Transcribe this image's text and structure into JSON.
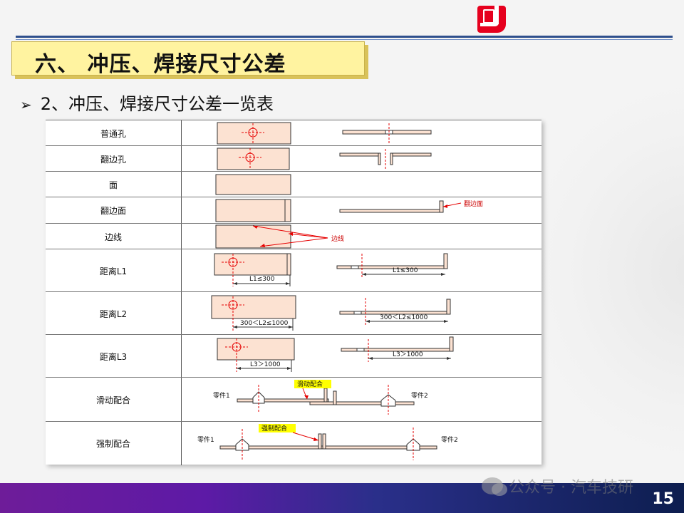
{
  "slide": {
    "title": "六、 冲压、焊接尺寸公差",
    "bullet": "2、冲压、焊接尺寸公差一览表",
    "page_number": "15",
    "watermark": "公众号 · 汽车技研"
  },
  "table": {
    "rows": [
      {
        "label": "普通孔"
      },
      {
        "label": "翻边孔"
      },
      {
        "label": "面"
      },
      {
        "label": "翻边面",
        "note": "翻边面"
      },
      {
        "label": "边线",
        "note": "边线"
      },
      {
        "label": "距离L1",
        "dim": "L1≤300"
      },
      {
        "label": "距离L2",
        "dim": "300＜L2≤1000"
      },
      {
        "label": "距离L3",
        "dim": "L3＞1000"
      },
      {
        "label": "滑动配合",
        "tag": "滑动配合",
        "part1": "零件1",
        "part2": "零件2"
      },
      {
        "label": "强制配合",
        "tag": "强制配合",
        "part1": "零件1",
        "part2": "零件2"
      }
    ]
  },
  "colors": {
    "title_bg": "#fff3a0",
    "part_fill": "#fce2d2",
    "mark_red": "#e60000",
    "tag_yellow": "#ffff00",
    "bar_start": "#6e1c99",
    "bar_end": "#0d1e4f"
  }
}
